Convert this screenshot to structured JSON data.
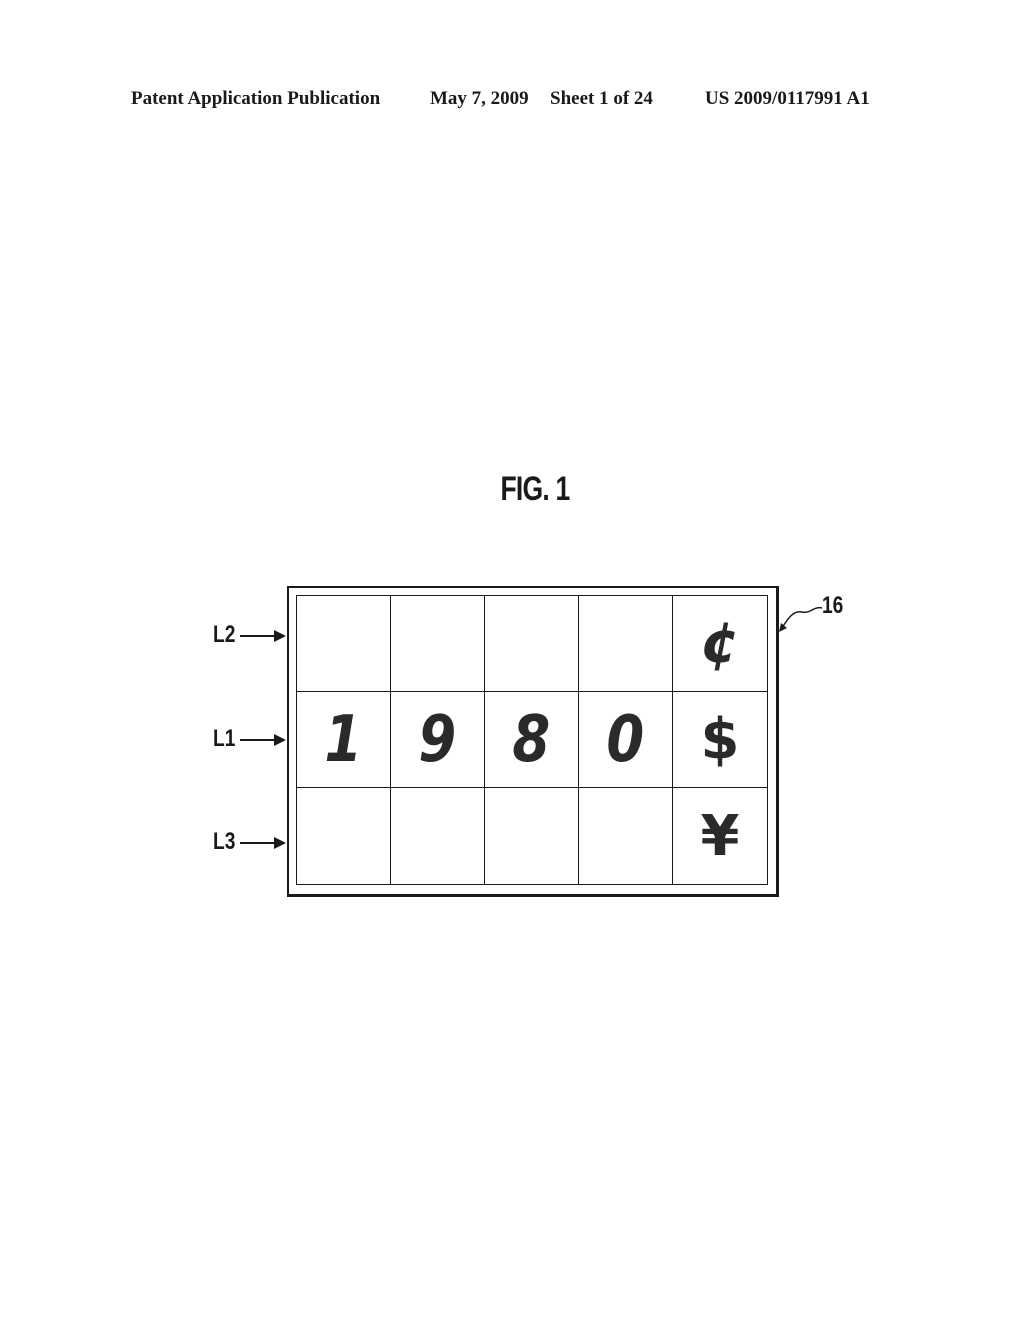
{
  "header": {
    "publication_type": "Patent Application Publication",
    "date": "May 7, 2009",
    "sheet": "Sheet 1 of 24",
    "publication_number": "US 2009/0117991 A1"
  },
  "figure": {
    "title": "FIG. 1",
    "reference_numeral": "16",
    "row_labels": [
      "L2",
      "L1",
      "L3"
    ],
    "grid": [
      [
        "",
        "",
        "",
        "",
        "¢"
      ],
      [
        "1",
        "9",
        "8",
        "0",
        "$"
      ],
      [
        "",
        "",
        "",
        "",
        "¥"
      ]
    ]
  }
}
